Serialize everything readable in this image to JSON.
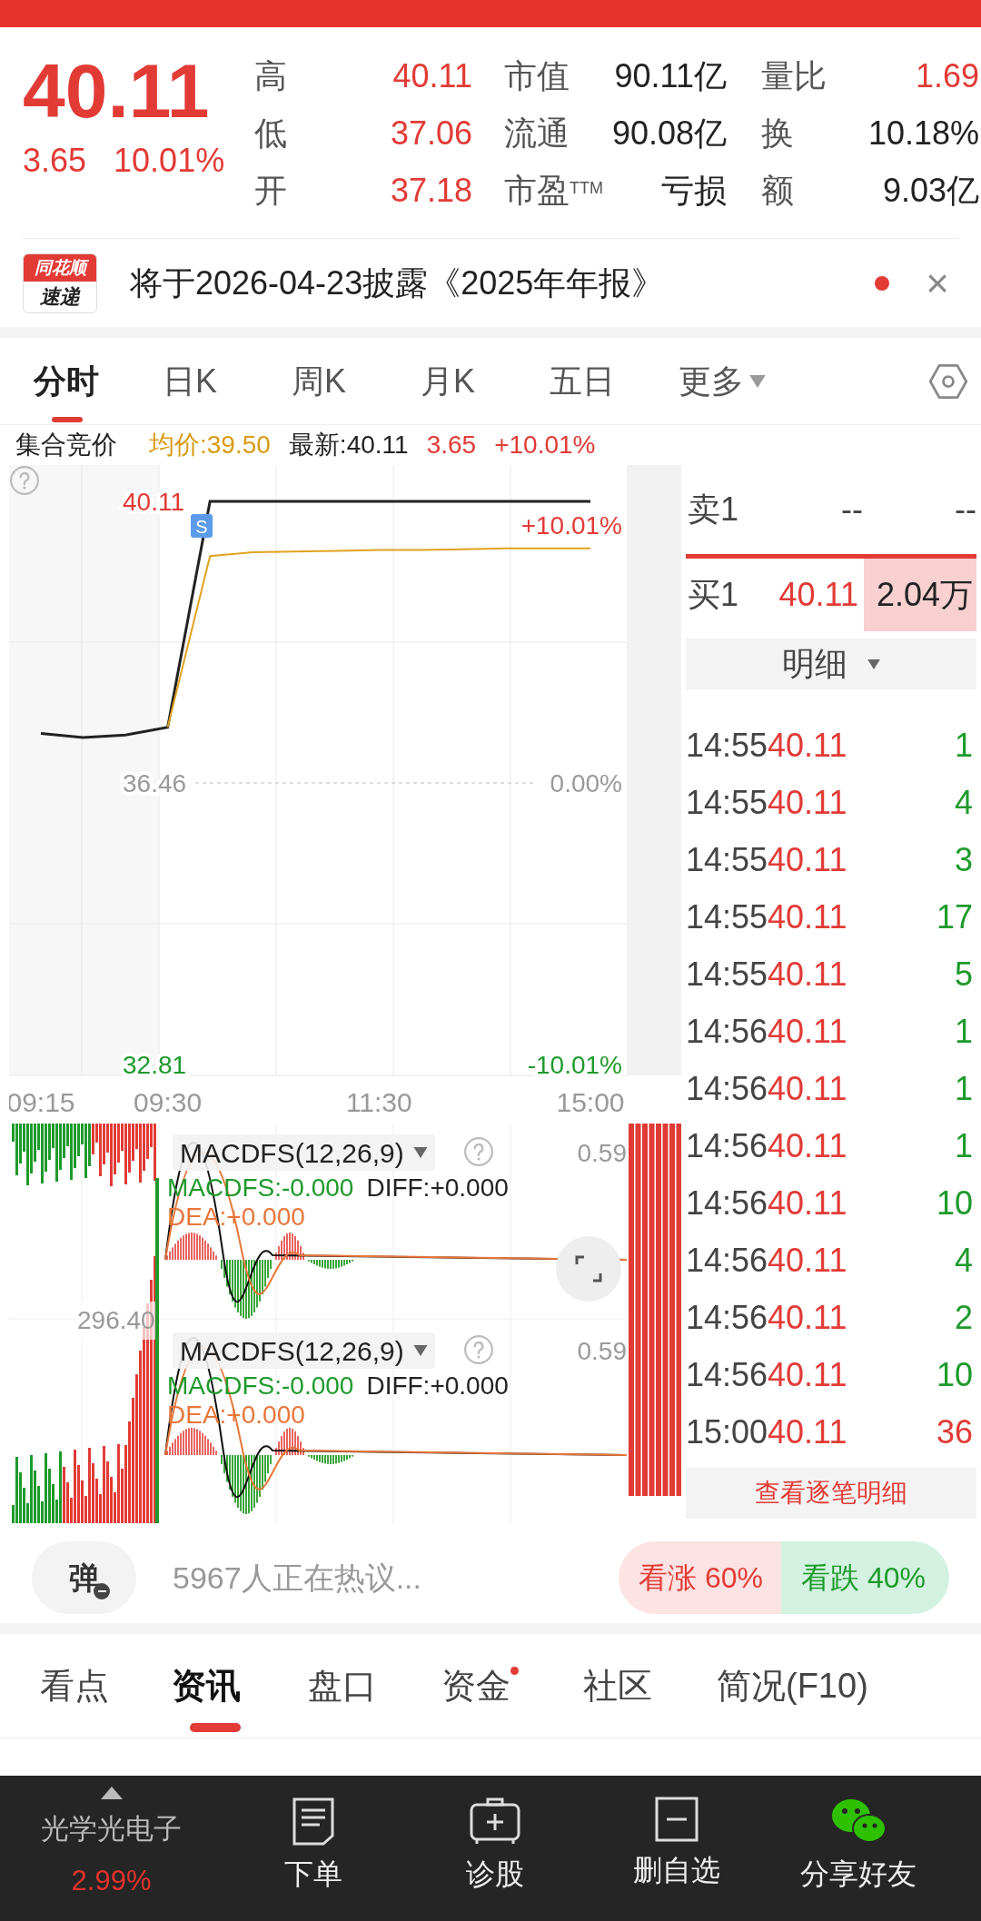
{
  "quote": {
    "price": "40.11",
    "change": "3.65",
    "change_pct": "10.01%",
    "stats": [
      [
        {
          "label": "高",
          "value": "40.11",
          "color": "#e23b36"
        },
        {
          "label": "市值",
          "value": "90.11亿",
          "color": "#222222"
        },
        {
          "label": "量比",
          "value": "1.69",
          "color": "#e23b36"
        }
      ],
      [
        {
          "label": "低",
          "value": "37.06",
          "color": "#e23b36"
        },
        {
          "label": "流通",
          "value": "90.08亿",
          "color": "#222222"
        },
        {
          "label": "换",
          "value": "10.18%",
          "color": "#222222"
        }
      ],
      [
        {
          "label": "开",
          "value": "37.18",
          "color": "#e23b36"
        },
        {
          "label": "市盈$^{TTM}$",
          "value": "亏损",
          "color": "#222222"
        },
        {
          "label": "额",
          "value": "9.03亿",
          "color": "#222222"
        }
      ]
    ]
  },
  "notice": {
    "badge_top": "同花顺",
    "badge_bottom": "速递",
    "text": "将于2026-04-23披露《2025年年报》",
    "unread": true,
    "close": "×"
  },
  "chart_tabs": [
    {
      "label": "分时",
      "selected": true,
      "kind": "plain"
    },
    {
      "label": "日K",
      "selected": false,
      "kind": "plain"
    },
    {
      "label": "周K",
      "selected": false,
      "kind": "plain"
    },
    {
      "label": "月K",
      "selected": false,
      "kind": "plain"
    },
    {
      "label": "五日",
      "selected": false,
      "kind": "plain"
    },
    {
      "label": "更多",
      "selected": false,
      "kind": "menu"
    }
  ],
  "info_bar": {
    "title": "集合竞价",
    "average": "均价:39.50",
    "latest": "最新:40.11",
    "change": "3.65",
    "change_pct": "+10.01%"
  },
  "price_chart": {
    "marker": "S",
    "percent_labels": [
      "+10.01%",
      "0.00%",
      "-10.01%"
    ],
    "chart_data": {
      "type": "line",
      "categories": [
        "09:15",
        null,
        null,
        "09:30",
        null,
        null,
        null,
        null,
        "11:30",
        null,
        null,
        null,
        null,
        "15:00"
      ],
      "series": [
        {
          "color": "#222222",
          "values": [
            37.1,
            37.05,
            37.08,
            37.18,
            40.11,
            40.11,
            40.11,
            40.11,
            40.11,
            40.11,
            40.11,
            40.11,
            40.11,
            40.11
          ]
        },
        {
          "color": "#e0a21e",
          "values": [
            null,
            null,
            null,
            37.18,
            39.4,
            39.45,
            39.46,
            39.47,
            39.48,
            39.48,
            39.49,
            39.5,
            39.5,
            39.5
          ]
        }
      ],
      "ylim": [
        32.81,
        40.11
      ],
      "grid": true,
      "yticks": [
        {
          "value": 40.11,
          "label": "40.11"
        },
        {
          "value": 36.46,
          "label": "36.46"
        },
        {
          "value": 32.81,
          "label": "32.81"
        }
      ]
    }
  },
  "order_book": {
    "sell": {
      "label": "卖1",
      "price": "--",
      "volume": "--"
    },
    "buy": {
      "label": "买1",
      "price": "40.11",
      "volume": "2.04万"
    },
    "details_button": "明细"
  },
  "trades": [
    {
      "time": "14:55",
      "price": "40.11",
      "volume": "1",
      "color": "#1e9a2c"
    },
    {
      "time": "14:55",
      "price": "40.11",
      "volume": "4",
      "color": "#1e9a2c"
    },
    {
      "time": "14:55",
      "price": "40.11",
      "volume": "3",
      "color": "#1e9a2c"
    },
    {
      "time": "14:55",
      "price": "40.11",
      "volume": "17",
      "color": "#1e9a2c"
    },
    {
      "time": "14:55",
      "price": "40.11",
      "volume": "5",
      "color": "#1e9a2c"
    },
    {
      "time": "14:56",
      "price": "40.11",
      "volume": "1",
      "color": "#1e9a2c"
    },
    {
      "time": "14:56",
      "price": "40.11",
      "volume": "1",
      "color": "#1e9a2c"
    },
    {
      "time": "14:56",
      "price": "40.11",
      "volume": "1",
      "color": "#1e9a2c"
    },
    {
      "time": "14:56",
      "price": "40.11",
      "volume": "10",
      "color": "#1e9a2c"
    },
    {
      "time": "14:56",
      "price": "40.11",
      "volume": "4",
      "color": "#1e9a2c"
    },
    {
      "time": "14:56",
      "price": "40.11",
      "volume": "2",
      "color": "#1e9a2c"
    },
    {
      "time": "14:56",
      "price": "40.11",
      "volume": "10",
      "color": "#1e9a2c"
    },
    {
      "time": "15:00",
      "price": "40.11",
      "volume": "36",
      "color": "#e23b36"
    }
  ],
  "trades_link": "查看逐笔明细",
  "volume_label": "296.40",
  "indicators": [
    {
      "name": "MACDFS(12,26,9)",
      "max": "0.59",
      "macdfs": "MACDFS:-0.000",
      "diff": "DIFF:+0.000",
      "dea": "DEA:+0.000",
      "expandable": true
    },
    {
      "name": "MACDFS(12,26,9)",
      "max": "0.59",
      "macdfs": "MACDFS:-0.000",
      "diff": "DIFF:+0.000",
      "dea": "DEA:+0.000",
      "expandable": false
    }
  ],
  "comment_bar": {
    "button": "弹",
    "placeholder": "5967人正在热议...",
    "votes": [
      {
        "label": "看涨 60%",
        "kind": "up"
      },
      {
        "label": "看跌 40%",
        "kind": "down"
      }
    ]
  },
  "section_tabs": [
    {
      "label": "看点",
      "selected": false,
      "dot": false
    },
    {
      "label": "资讯",
      "selected": true,
      "dot": false
    },
    {
      "label": "盘口",
      "selected": false,
      "dot": false
    },
    {
      "label": "资金",
      "selected": false,
      "dot": true
    },
    {
      "label": "社区",
      "selected": false,
      "dot": false
    },
    {
      "label": "简况(F10)",
      "selected": false,
      "dot": false
    }
  ],
  "bottom_nav": {
    "sector": {
      "name": "光学光电子",
      "change": "2.99%"
    },
    "items": [
      {
        "label": "下单",
        "kind": "order"
      },
      {
        "label": "诊股",
        "kind": "diagnose"
      },
      {
        "label": "删自选",
        "kind": "remove"
      },
      {
        "label": "分享好友",
        "kind": "share"
      }
    ]
  }
}
